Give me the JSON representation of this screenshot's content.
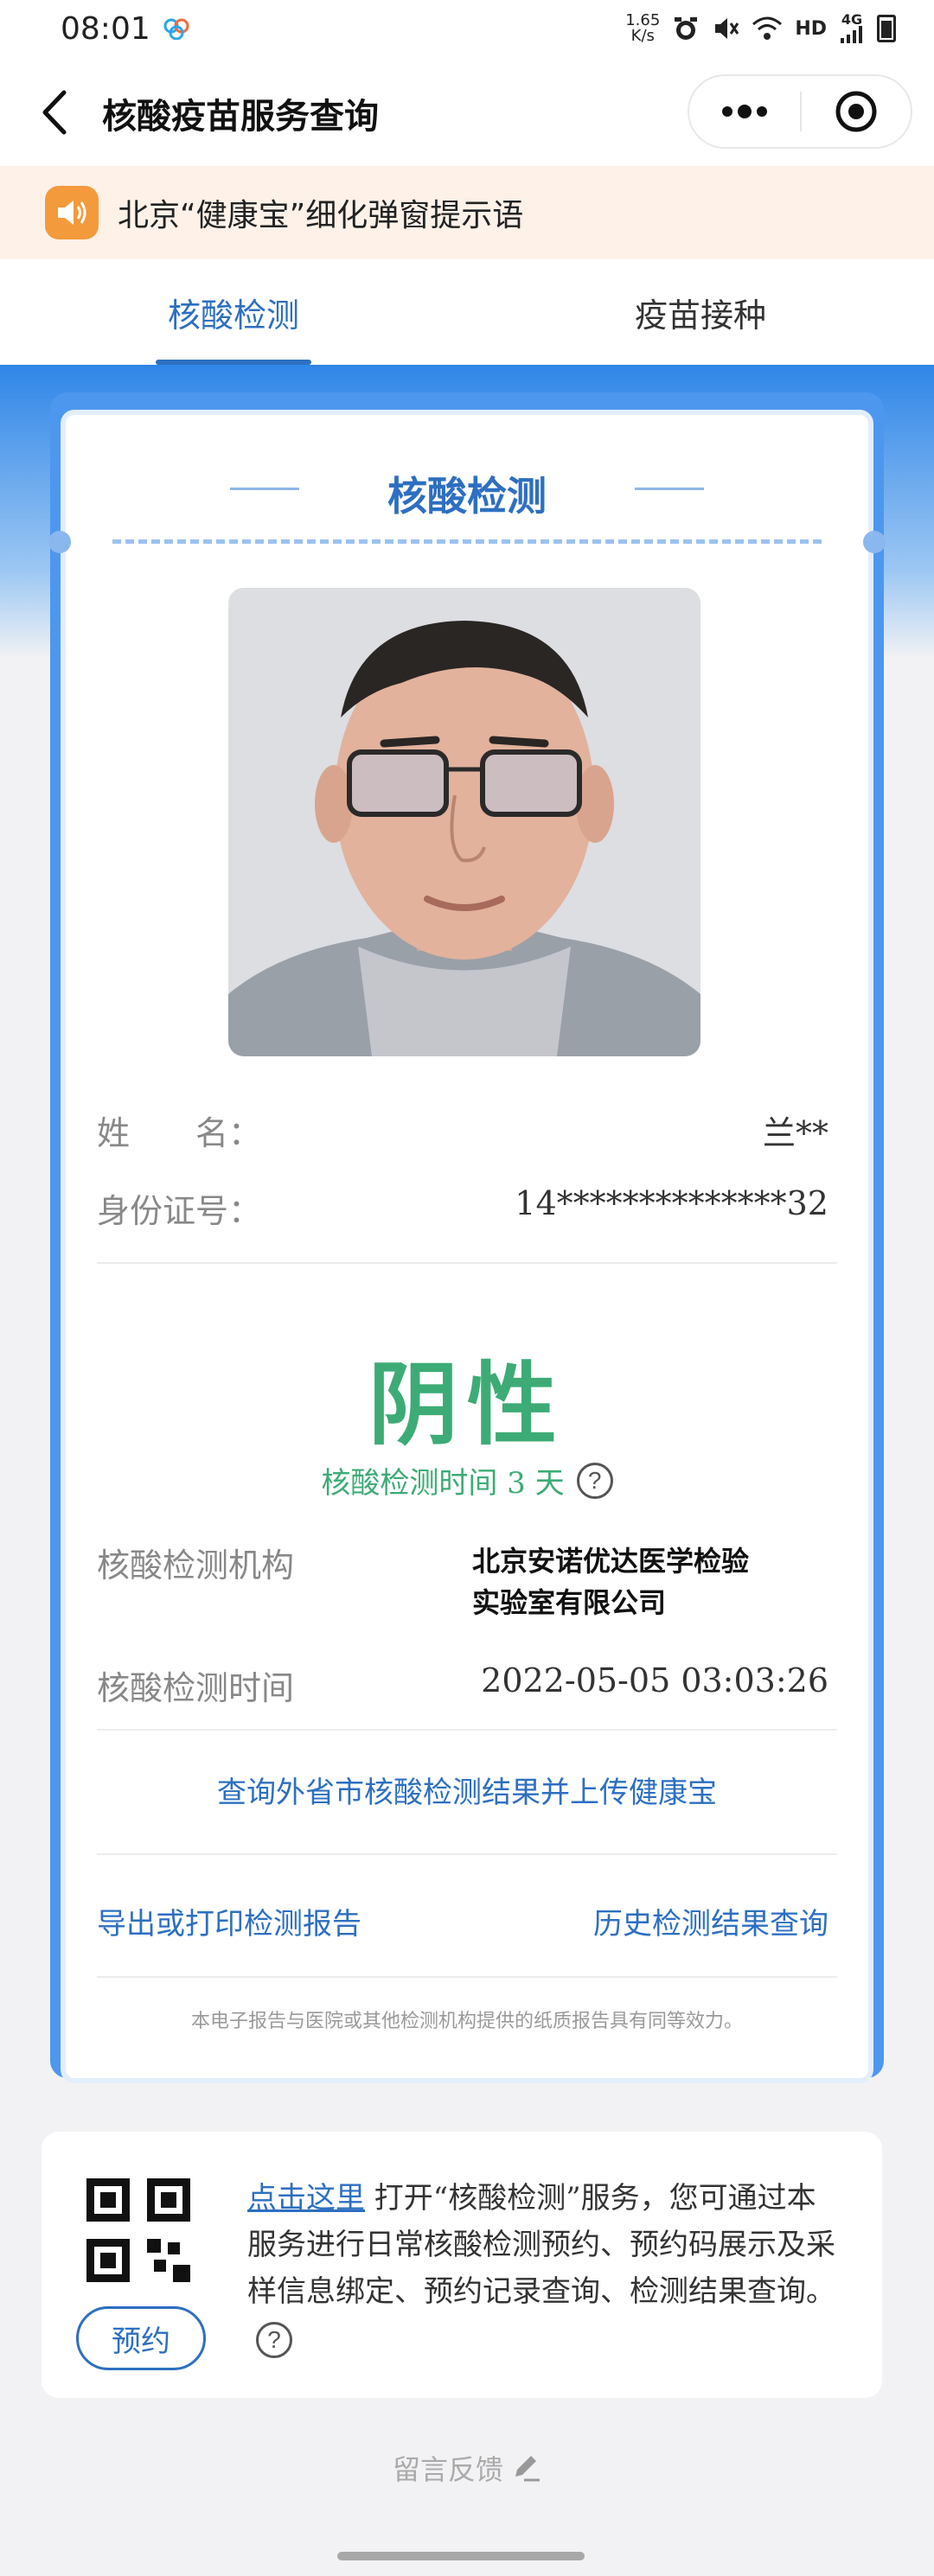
{
  "status_bar": {
    "time": "08:01",
    "net_speed_value": "1.65",
    "net_speed_unit": "K/s",
    "hd": "HD",
    "signal": "4G"
  },
  "nav": {
    "title": "核酸疫苗服务查询"
  },
  "notice": {
    "text": "北京“健康宝”细化弹窗提示语"
  },
  "tabs": [
    {
      "label": "核酸检测",
      "active": true
    },
    {
      "label": "疫苗接种",
      "active": false
    }
  ],
  "card": {
    "title": "核酸检测",
    "name_label": "姓　　名：",
    "name_value": "兰**",
    "id_label": "身份证号：",
    "id_value": "14**************32",
    "result": "阴性",
    "duration_label": "核酸检测时间 3 天",
    "help_icon": "?",
    "institution_label": "核酸检测机构",
    "institution_value_line1": "北京安诺优达医学检验",
    "institution_value_line2": "实验室有限公司",
    "time_label": "核酸检测时间",
    "time_value": "2022-05-05 03:03:26",
    "query_other_link": "查询外省市核酸检测结果并上传健康宝",
    "export_link": "导出或打印检测报告",
    "history_link": "历史检测结果查询",
    "footnote": "本电子报告与医院或其他检测机构提供的纸质报告具有同等效力。"
  },
  "booking": {
    "button": "预约",
    "click_here": "点击这里",
    "text": " 打开“核酸检测”服务，您可通过本服务进行日常核酸检测预约、预约码展示及采样信息绑定、预约记录查询、检测结果查询。",
    "help_icon": "?"
  },
  "feedback": {
    "label": "留言反馈"
  },
  "colors": {
    "primary": "#2d6fc1",
    "negative_green": "#3dab75",
    "notice_bg": "#fdf1e8",
    "notice_icon": "#f39a3c"
  }
}
